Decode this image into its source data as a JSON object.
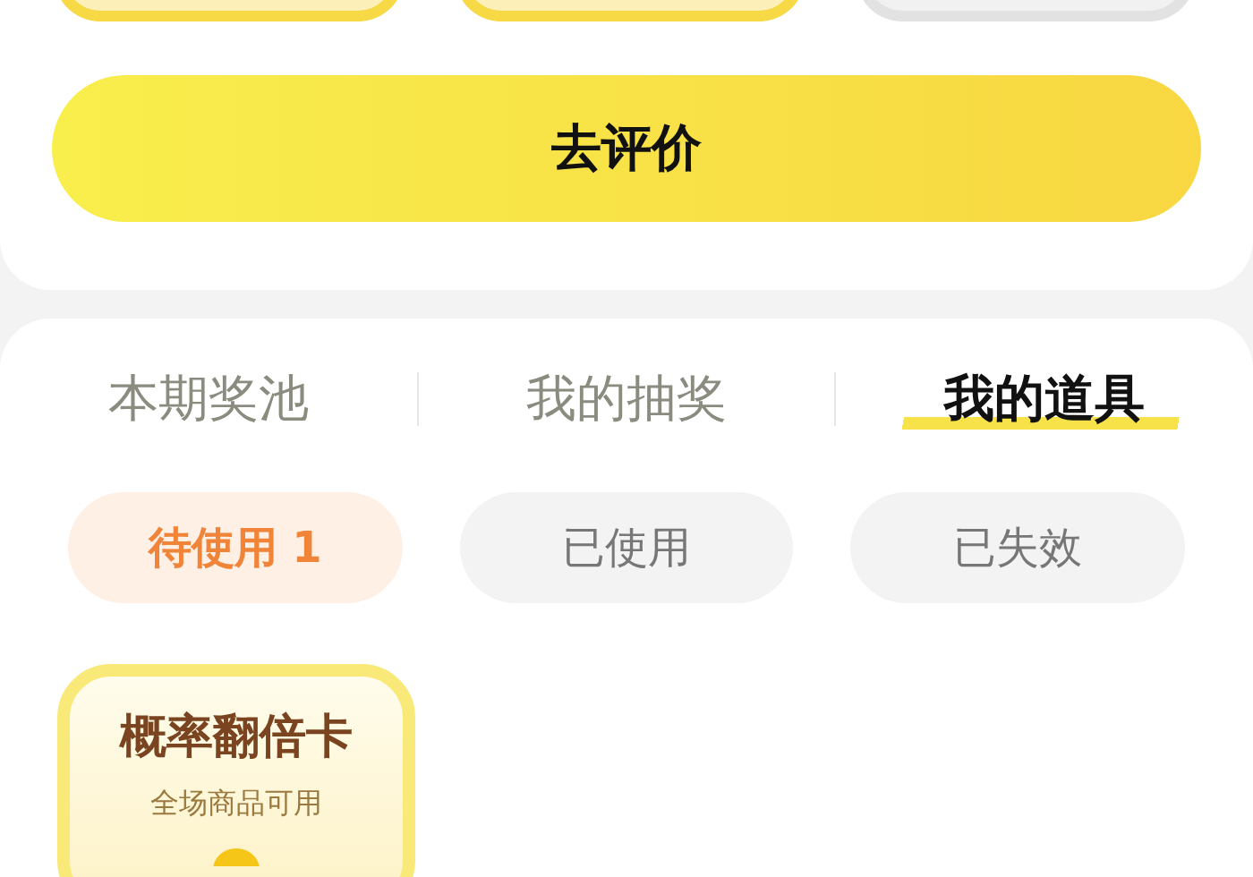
{
  "top_cards": [
    {
      "kind": "gold"
    },
    {
      "kind": "gold"
    },
    {
      "kind": "grey"
    }
  ],
  "review_button": {
    "label": "去评价"
  },
  "tabs": [
    {
      "label": "本期奖池",
      "selected": false
    },
    {
      "label": "我的抽奖",
      "selected": false
    },
    {
      "label": "我的道具",
      "selected": true
    }
  ],
  "filters": [
    {
      "label": "待使用 1",
      "selected": true
    },
    {
      "label": "已使用",
      "selected": false
    },
    {
      "label": "已失效",
      "selected": false
    }
  ],
  "items": [
    {
      "title": "概率翻倍卡",
      "subtitle": "全场商品可用"
    }
  ]
}
